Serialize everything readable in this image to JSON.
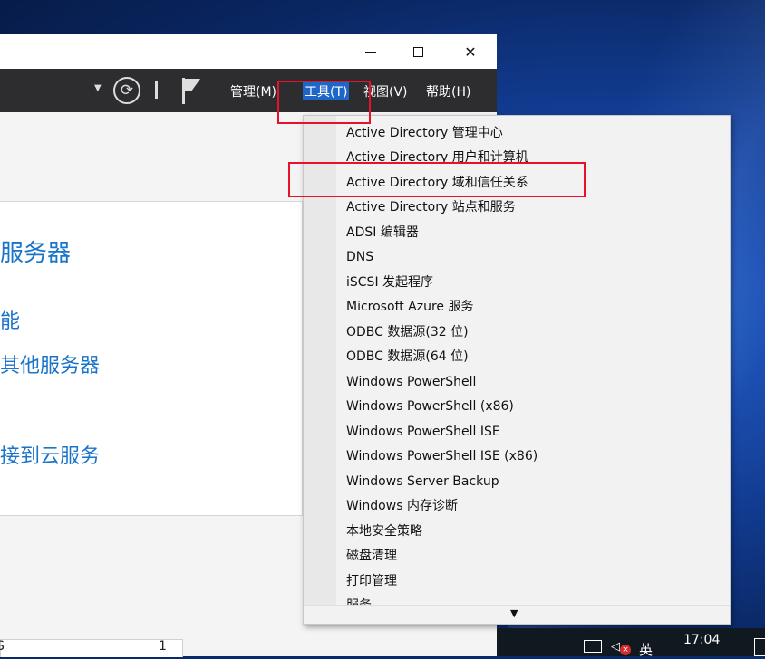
{
  "window": {
    "menu": {
      "manage": "管理(M)",
      "tools": "工具(T)",
      "view": "视图(V)",
      "help": "帮助(H)"
    },
    "icons": [
      "dropdown-arrow-icon",
      "refresh-icon",
      "flag-icon"
    ]
  },
  "panel": {
    "title": "服务器",
    "line1": "能",
    "line2": "其他服务器",
    "line3": "",
    "line4": "接到云服务"
  },
  "lower": {
    "cell_a": "S",
    "cell_b": "1"
  },
  "tools_menu": {
    "items": [
      "Active Directory 管理中心",
      "Active Directory 用户和计算机",
      "Active Directory 域和信任关系",
      "Active Directory 站点和服务",
      "ADSI 编辑器",
      "DNS",
      "iSCSI 发起程序",
      "Microsoft Azure 服务",
      "ODBC 数据源(32 位)",
      "ODBC 数据源(64 位)",
      "Windows PowerShell",
      "Windows PowerShell (x86)",
      "Windows PowerShell ISE",
      "Windows PowerShell ISE (x86)",
      "Windows Server Backup",
      "Windows 内存诊断",
      "本地安全策略",
      "磁盘清理",
      "打印管理",
      "服务"
    ],
    "scroll_indicator": "▼"
  },
  "taskbar": {
    "ime": "英",
    "clock": "17:04"
  },
  "colors": {
    "highlight": "#e8102b",
    "accent_link": "#1a74c9",
    "menubar_bg": "#2d2d30"
  }
}
